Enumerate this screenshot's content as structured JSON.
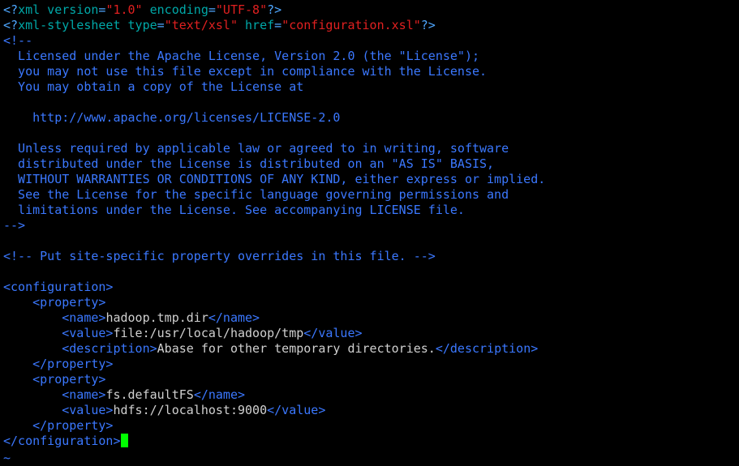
{
  "colors": {
    "background": "#000000",
    "tag": "#3b78ff",
    "pi": "#4ea7ff",
    "attr_name": "#00a8a8",
    "string": "#e02020",
    "comment": "#3b78ff",
    "text": "#d0d0d0",
    "cursor": "#00ff00",
    "tilde": "#3b78ff"
  },
  "editor": {
    "lines": [
      [
        [
          "pi",
          "<?"
        ],
        [
          "attr",
          "xml version"
        ],
        [
          "pi",
          "="
        ],
        [
          "str",
          "\"1.0\""
        ],
        [
          "attr",
          " encoding"
        ],
        [
          "pi",
          "="
        ],
        [
          "str",
          "\"UTF-8\""
        ],
        [
          "pi",
          "?>"
        ]
      ],
      [
        [
          "pi",
          "<?"
        ],
        [
          "attr",
          "xml-stylesheet type"
        ],
        [
          "pi",
          "="
        ],
        [
          "str",
          "\"text/xsl\""
        ],
        [
          "attr",
          " href"
        ],
        [
          "pi",
          "="
        ],
        [
          "str",
          "\"configuration.xsl\""
        ],
        [
          "pi",
          "?>"
        ]
      ],
      [
        [
          "comment",
          "<!--"
        ]
      ],
      [
        [
          "comment",
          "  Licensed under the Apache License, Version 2.0 (the \"License\");"
        ]
      ],
      [
        [
          "comment",
          "  you may not use this file except in compliance with the License."
        ]
      ],
      [
        [
          "comment",
          "  You may obtain a copy of the License at"
        ]
      ],
      [
        [
          "comment",
          ""
        ]
      ],
      [
        [
          "comment",
          "    http://www.apache.org/licenses/LICENSE-2.0"
        ]
      ],
      [
        [
          "comment",
          ""
        ]
      ],
      [
        [
          "comment",
          "  Unless required by applicable law or agreed to in writing, software"
        ]
      ],
      [
        [
          "comment",
          "  distributed under the License is distributed on an \"AS IS\" BASIS,"
        ]
      ],
      [
        [
          "comment",
          "  WITHOUT WARRANTIES OR CONDITIONS OF ANY KIND, either express or implied."
        ]
      ],
      [
        [
          "comment",
          "  See the License for the specific language governing permissions and"
        ]
      ],
      [
        [
          "comment",
          "  limitations under the License. See accompanying LICENSE file."
        ]
      ],
      [
        [
          "comment",
          "-->"
        ]
      ],
      [
        [
          "text",
          ""
        ]
      ],
      [
        [
          "comment",
          "<!-- Put site-specific property overrides in this file. -->"
        ]
      ],
      [
        [
          "text",
          ""
        ]
      ],
      [
        [
          "tag",
          "<configuration>"
        ]
      ],
      [
        [
          "text",
          "    "
        ],
        [
          "tag",
          "<property>"
        ]
      ],
      [
        [
          "text",
          "        "
        ],
        [
          "tag",
          "<name>"
        ],
        [
          "text",
          "hadoop.tmp.dir"
        ],
        [
          "tag",
          "</name>"
        ]
      ],
      [
        [
          "text",
          "        "
        ],
        [
          "tag",
          "<value>"
        ],
        [
          "text",
          "file:/usr/local/hadoop/tmp"
        ],
        [
          "tag",
          "</value>"
        ]
      ],
      [
        [
          "text",
          "        "
        ],
        [
          "tag",
          "<description>"
        ],
        [
          "text",
          "Abase for other temporary directories."
        ],
        [
          "tag",
          "</description>"
        ]
      ],
      [
        [
          "text",
          "    "
        ],
        [
          "tag",
          "</property>"
        ]
      ],
      [
        [
          "text",
          "    "
        ],
        [
          "tag",
          "<property>"
        ]
      ],
      [
        [
          "text",
          "        "
        ],
        [
          "tag",
          "<name>"
        ],
        [
          "text",
          "fs.defaultFS"
        ],
        [
          "tag",
          "</name>"
        ]
      ],
      [
        [
          "text",
          "        "
        ],
        [
          "tag",
          "<value>"
        ],
        [
          "text",
          "hdfs://localhost:9000"
        ],
        [
          "tag",
          "</value>"
        ]
      ],
      [
        [
          "text",
          "    "
        ],
        [
          "tag",
          "</property>"
        ]
      ],
      [
        [
          "tag",
          "</configuration>"
        ],
        [
          "cursor",
          ""
        ]
      ]
    ],
    "tilde": "~"
  }
}
